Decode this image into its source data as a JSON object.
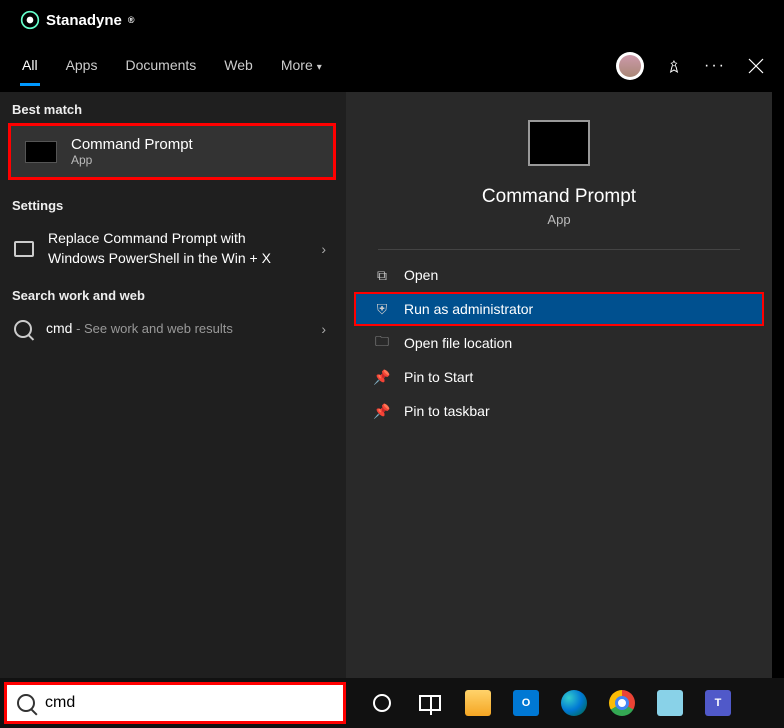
{
  "brand": "Stanadyne",
  "tabs": [
    "All",
    "Apps",
    "Documents",
    "Web",
    "More"
  ],
  "active_tab": 0,
  "left": {
    "best_match_header": "Best match",
    "best_match": {
      "title": "Command Prompt",
      "subtitle": "App"
    },
    "settings_header": "Settings",
    "settings_item": "Replace Command Prompt with Windows PowerShell in the Win + X",
    "search_header": "Search work and web",
    "search_item_prefix": "cmd",
    "search_item_suffix": " - See work and web results"
  },
  "right": {
    "title": "Command Prompt",
    "subtitle": "App",
    "actions": [
      "Open",
      "Run as administrator",
      "Open file location",
      "Pin to Start",
      "Pin to taskbar"
    ],
    "highlighted_action": 1
  },
  "search_value": "cmd"
}
